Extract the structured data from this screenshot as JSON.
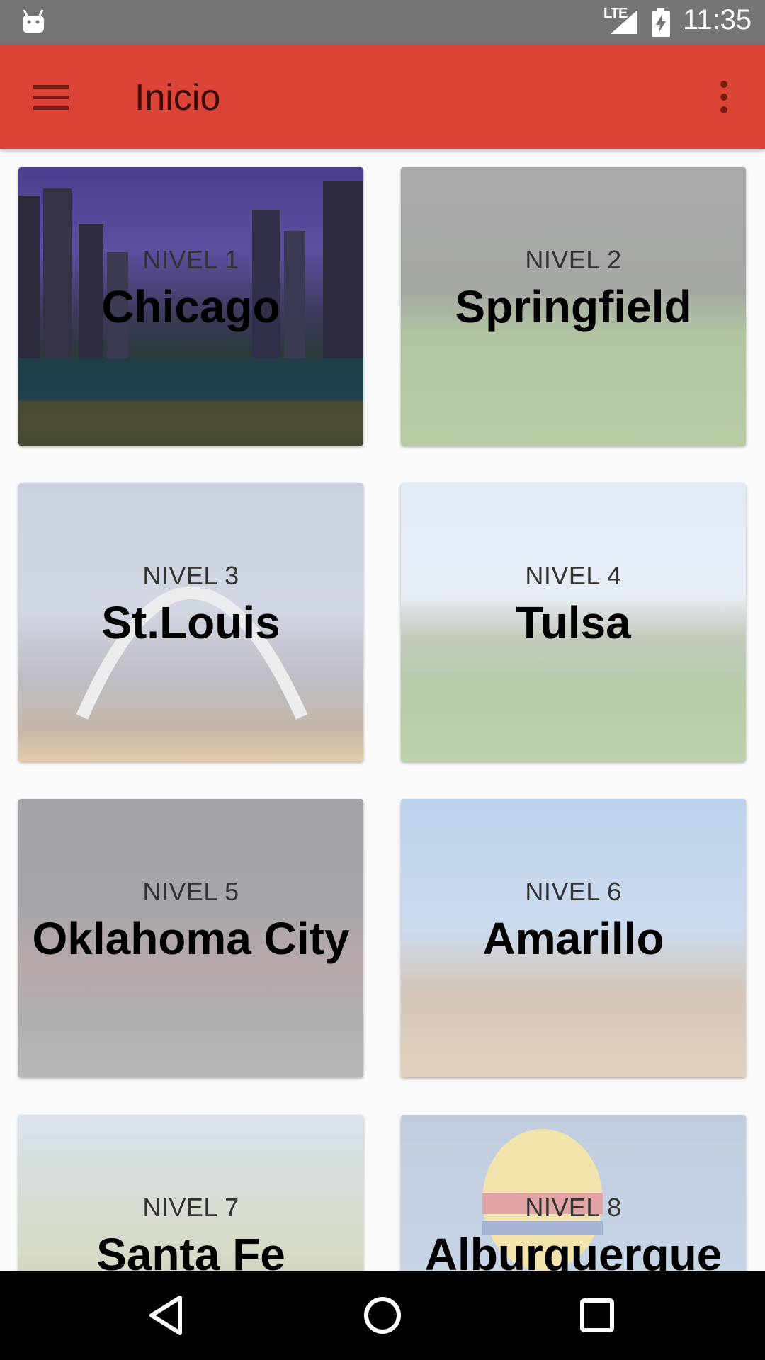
{
  "status_bar": {
    "time": "11:35",
    "network": "LTE",
    "icons": [
      "android-icon",
      "lte-signal-icon",
      "battery-charging-icon"
    ]
  },
  "app_bar": {
    "title": "Inicio",
    "accent_color": "#db4437",
    "icons": [
      "menu-icon",
      "more-vert-icon"
    ]
  },
  "levels": [
    {
      "level": "NIVEL 1",
      "city": "Chicago"
    },
    {
      "level": "NIVEL 2",
      "city": "Springfield"
    },
    {
      "level": "NIVEL 3",
      "city": "St.Louis"
    },
    {
      "level": "NIVEL 4",
      "city": "Tulsa"
    },
    {
      "level": "NIVEL 5",
      "city": "Oklahoma City"
    },
    {
      "level": "NIVEL 6",
      "city": "Amarillo"
    },
    {
      "level": "NIVEL 7",
      "city": "Santa Fe"
    },
    {
      "level": "NIVEL 8",
      "city": "Alburquerque"
    }
  ],
  "nav_bar": {
    "icons": [
      "back-icon",
      "home-icon",
      "recents-icon"
    ]
  }
}
